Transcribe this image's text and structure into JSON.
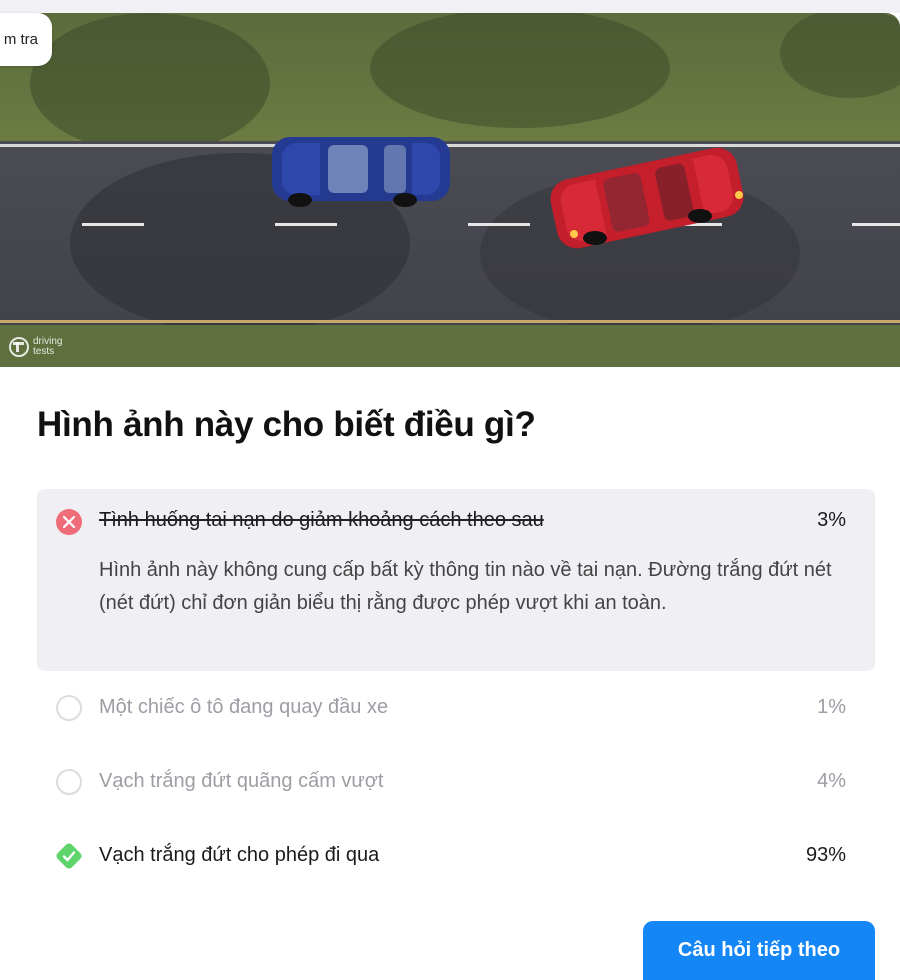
{
  "top_button": {
    "label": "m tra"
  },
  "hero": {
    "alt_logo": [
      "driving",
      "tests"
    ]
  },
  "question": {
    "title": "Hình ảnh này cho biết điều gì?"
  },
  "options": [
    {
      "label": "Tình huống tai nạn do giảm khoảng cách theo sau",
      "percent": "3%",
      "state": "selected-wrong",
      "explanation": "Hình ảnh này không cung cấp bất kỳ thông tin nào về tai nạn. Đường trắng đứt nét (nét đứt) chỉ đơn giản biểu thị rằng được phép vượt khi an toàn."
    },
    {
      "label": "Một chiếc ô tô đang quay đầu xe",
      "percent": "1%",
      "state": "unselected"
    },
    {
      "label": "Vạch trắng đứt quãng cấm vượt",
      "percent": "4%",
      "state": "unselected"
    },
    {
      "label": "Vạch trắng đứt cho phép đi qua",
      "percent": "93%",
      "state": "correct"
    }
  ],
  "footer": {
    "next_label": "Câu hỏi tiếp theo"
  },
  "colors": {
    "wrong": "#ee6d78",
    "correct": "#5fd46a",
    "primary_button": "#1486f5",
    "selected_bg": "#f0eff4"
  }
}
